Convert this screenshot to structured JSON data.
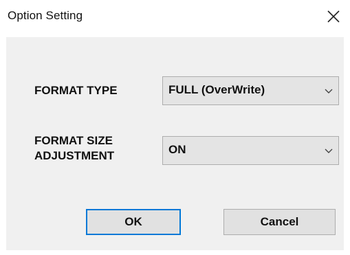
{
  "window": {
    "title": "Option Setting",
    "close_icon": "close-icon"
  },
  "form": {
    "format_type": {
      "label": "FORMAT TYPE",
      "value": "FULL (OverWrite)"
    },
    "format_size_adjustment": {
      "label_line1": "FORMAT SIZE",
      "label_line2": "ADJUSTMENT",
      "value": "ON"
    }
  },
  "buttons": {
    "ok_label": "OK",
    "cancel_label": "Cancel"
  },
  "colors": {
    "body_background": "#f0f0f0",
    "default_button_border": "#0078d7",
    "control_background": "#e1e1e1"
  }
}
